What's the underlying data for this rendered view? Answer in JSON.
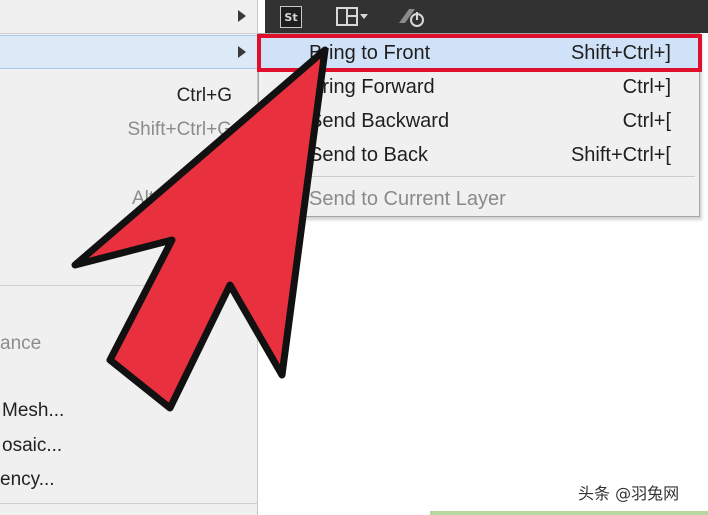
{
  "left_menu": {
    "rows": [
      {
        "label": "",
        "shortcut": ""
      },
      {
        "label": "",
        "shortcut": ""
      },
      {
        "label": "",
        "shortcut": "Ctrl+G"
      },
      {
        "label": "",
        "shortcut": "Shift+Ctrl+G"
      },
      {
        "label": "",
        "shortcut": "Alt"
      },
      {
        "label": "ance"
      },
      {
        "label": "Mesh..."
      },
      {
        "label": "osaic..."
      },
      {
        "label": "ency..."
      }
    ]
  },
  "arrange_submenu": {
    "items": [
      {
        "label": "Bring to Front",
        "shortcut": "Shift+Ctrl+]"
      },
      {
        "label": "Bring Forward",
        "shortcut": "Ctrl+]"
      },
      {
        "label": "Send Backward",
        "shortcut": "Ctrl+["
      },
      {
        "label": "Send to Back",
        "shortcut": "Shift+Ctrl+["
      },
      {
        "label": "Send to Current Layer",
        "shortcut": ""
      }
    ]
  },
  "toolbar": {
    "stock_label": "St"
  },
  "watermark": "头条 @羽兔网",
  "colors": {
    "highlight_box": "#e0102c",
    "pointer_fill": "#e8303f",
    "menu_bg": "#f0f0f0"
  }
}
